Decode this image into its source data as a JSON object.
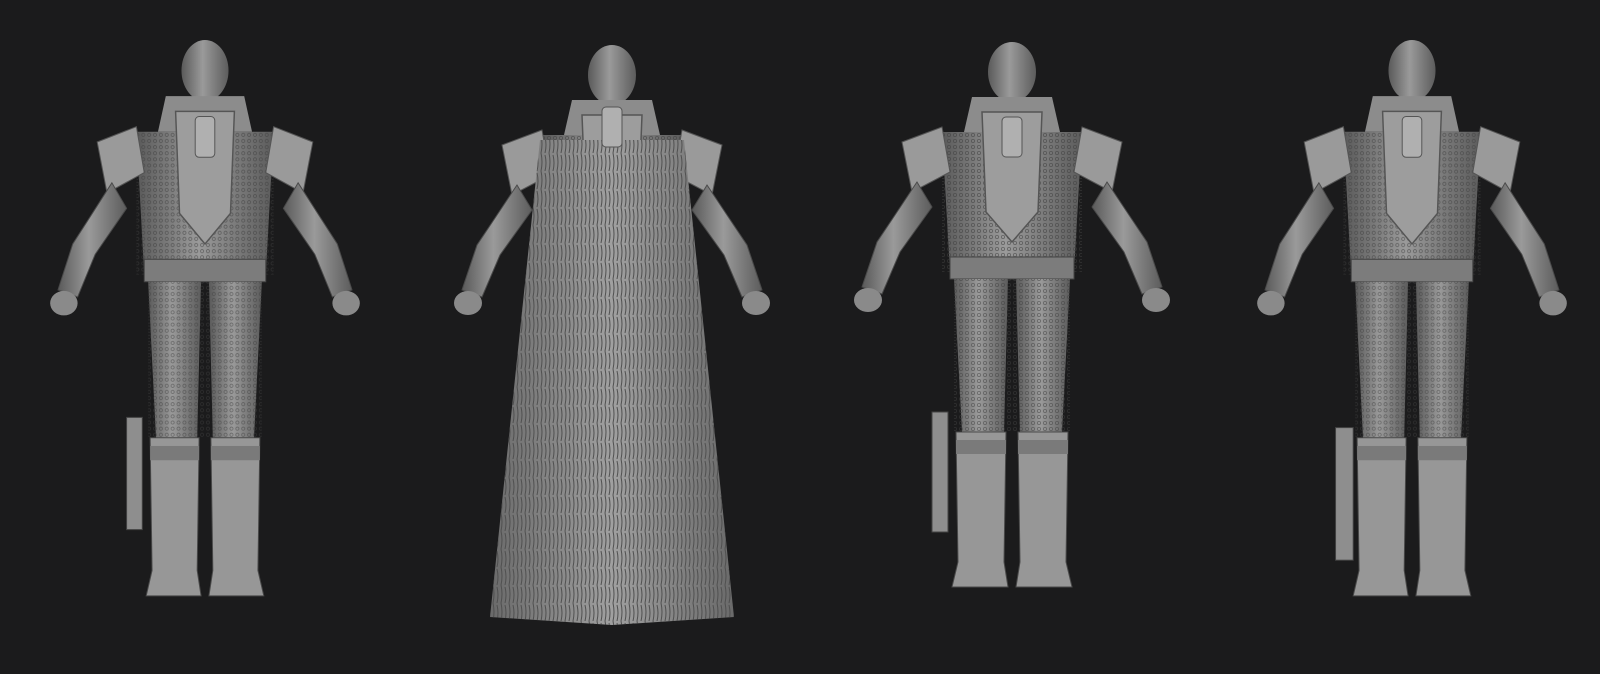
{
  "canvas": {
    "background": "#1b1b1c",
    "model_color": "#8a8a8a",
    "model_shadow": "#5e5e5e",
    "model_highlight": "#a6a6a6"
  },
  "views": [
    {
      "name": "three-quarter-back-left",
      "cape": false
    },
    {
      "name": "back-with-cape",
      "cape": true
    },
    {
      "name": "back",
      "cape": false
    },
    {
      "name": "three-quarter-back-right",
      "cape": false
    }
  ]
}
